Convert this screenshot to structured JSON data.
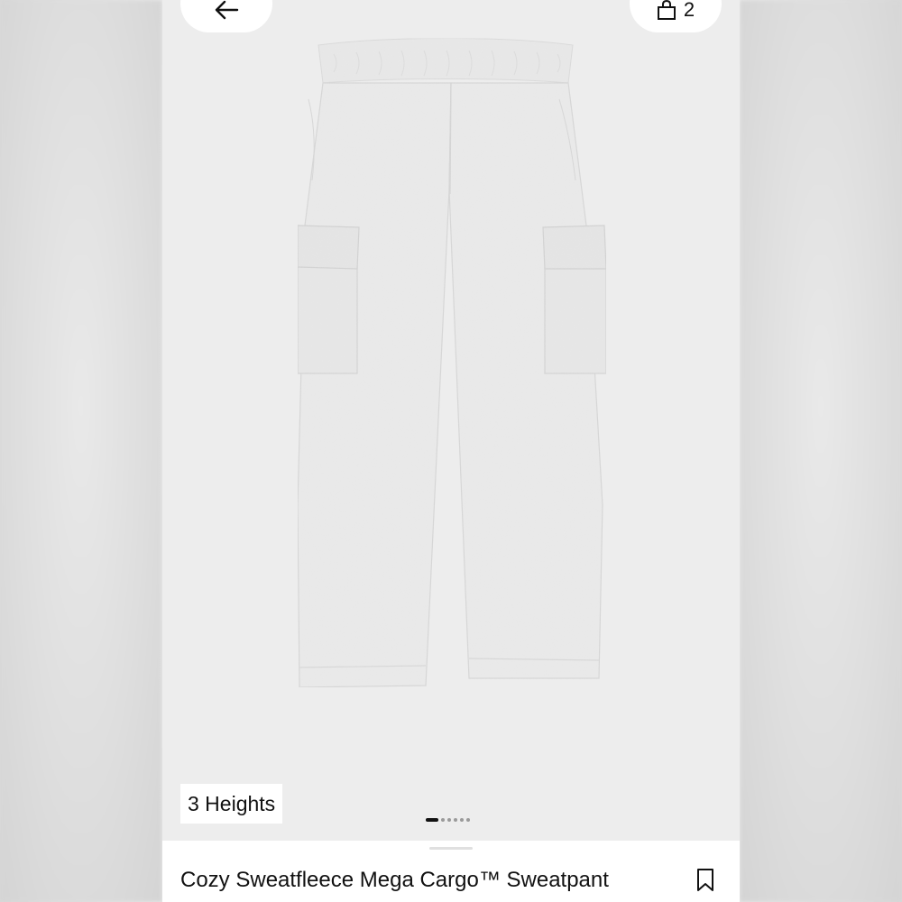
{
  "header": {
    "back_icon": "arrow-left-icon",
    "bag_icon": "shopping-bag-icon",
    "bag_count": "2"
  },
  "product_image": {
    "badge": "3 Heights",
    "carousel": {
      "total": 6,
      "active": 1
    },
    "colors": {
      "fabric": "#e8e8e8",
      "shadow": "#d6d6d6"
    }
  },
  "product": {
    "title": "Cozy Sweatfleece Mega Cargo™ Sweatpant",
    "save_icon": "bookmark-icon"
  }
}
